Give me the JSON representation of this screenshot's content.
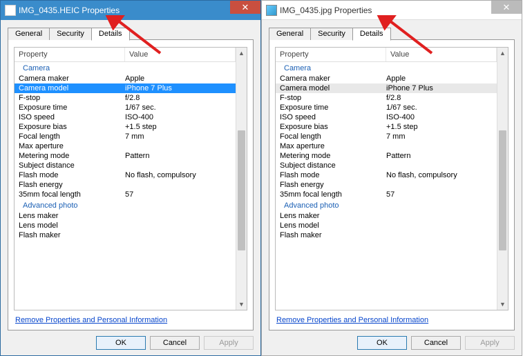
{
  "windows": {
    "left": {
      "title": "IMG_0435.HEIC Properties"
    },
    "right": {
      "title": "IMG_0435.jpg Properties"
    }
  },
  "tabs": {
    "general": "General",
    "security": "Security",
    "details": "Details"
  },
  "columns": {
    "property": "Property",
    "value": "Value"
  },
  "sections": {
    "camera": "Camera",
    "advanced_photo": "Advanced photo"
  },
  "camera_rows": {
    "maker": {
      "label": "Camera maker",
      "value": "Apple"
    },
    "model": {
      "label": "Camera model",
      "value": "iPhone 7 Plus"
    },
    "fstop": {
      "label": "F-stop",
      "value": "f/2.8"
    },
    "exposure": {
      "label": "Exposure time",
      "value": "1/67 sec."
    },
    "iso": {
      "label": "ISO speed",
      "value": "ISO-400"
    },
    "bias": {
      "label": "Exposure bias",
      "value": "+1.5 step"
    },
    "focal": {
      "label": "Focal length",
      "value": "7 mm"
    },
    "maxap": {
      "label": "Max aperture",
      "value": ""
    },
    "metering": {
      "label": "Metering mode",
      "value": "Pattern"
    },
    "subject": {
      "label": "Subject distance",
      "value": ""
    },
    "flash": {
      "label": "Flash mode",
      "value": "No flash, compulsory"
    },
    "flashenergy": {
      "label": "Flash energy",
      "value": ""
    },
    "focal35": {
      "label": "35mm focal length",
      "value": "57"
    }
  },
  "advanced_rows": {
    "lensmaker": {
      "label": "Lens maker",
      "value": ""
    },
    "lensmodel": {
      "label": "Lens model",
      "value": ""
    },
    "flashmaker": {
      "label": "Flash maker",
      "value": ""
    }
  },
  "remove_link": "Remove Properties and Personal Information",
  "buttons": {
    "ok": "OK",
    "cancel": "Cancel",
    "apply": "Apply"
  }
}
